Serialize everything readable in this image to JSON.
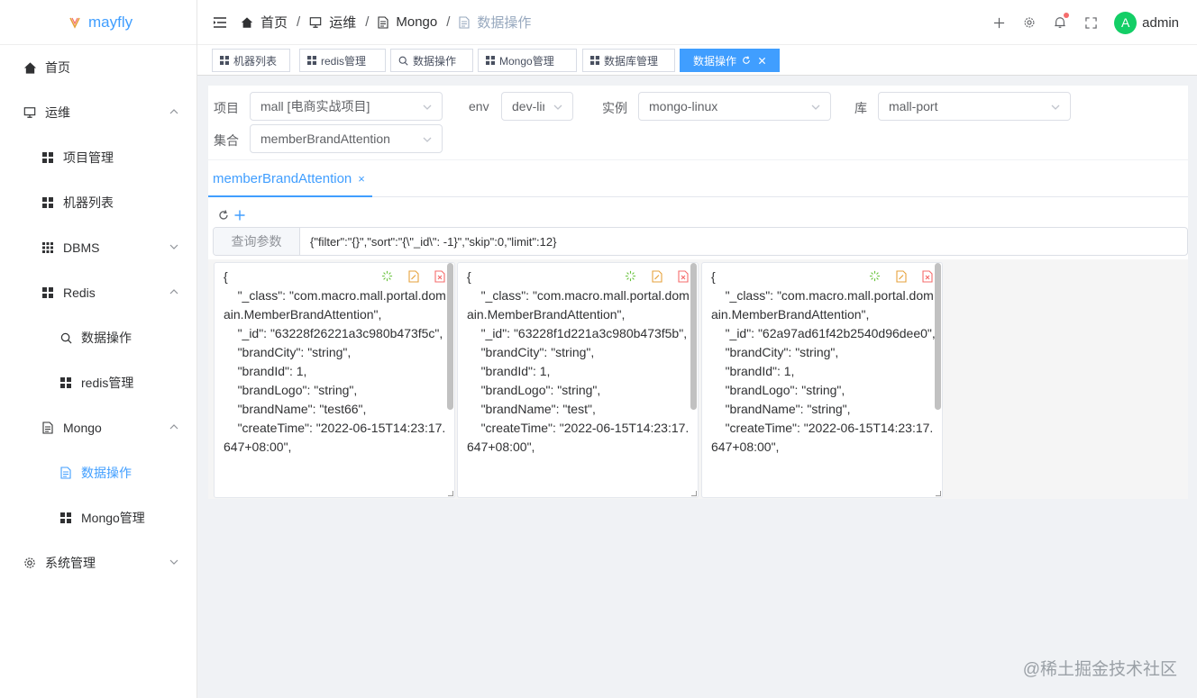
{
  "app": {
    "logo_text": "mayfly"
  },
  "sidebar": {
    "items": [
      {
        "label": "首页",
        "icon": "home-icon"
      },
      {
        "label": "运维",
        "icon": "monitor-icon",
        "expanded": true
      },
      {
        "label": "项目管理",
        "icon": "grid-icon"
      },
      {
        "label": "机器列表",
        "icon": "grid-icon"
      },
      {
        "label": "DBMS",
        "icon": "grid-icon",
        "expanded": false
      },
      {
        "label": "Redis",
        "icon": "grid-icon",
        "expanded": true
      },
      {
        "label": "数据操作",
        "icon": "search-icon"
      },
      {
        "label": "redis管理",
        "icon": "grid-icon"
      },
      {
        "label": "Mongo",
        "icon": "document-icon",
        "expanded": true
      },
      {
        "label": "数据操作",
        "icon": "document-icon",
        "active": true
      },
      {
        "label": "Mongo管理",
        "icon": "grid-icon"
      },
      {
        "label": "系统管理",
        "icon": "gear-icon",
        "expanded": false
      }
    ]
  },
  "header": {
    "breadcrumb": [
      "首页",
      "运维",
      "Mongo",
      "数据操作"
    ],
    "user": "admin",
    "avatar_letter": "A"
  },
  "tags": [
    {
      "label": "机器列表",
      "icon": "grid-icon"
    },
    {
      "label": "redis管理",
      "icon": "grid-icon"
    },
    {
      "label": "数据操作",
      "icon": "search-icon"
    },
    {
      "label": "Mongo管理",
      "icon": "grid-icon"
    },
    {
      "label": "数据库管理",
      "icon": "grid-icon"
    },
    {
      "label": "数据操作",
      "icon": "document-icon",
      "active": true
    }
  ],
  "filters": {
    "project_label": "项目",
    "project_value": "mall [电商实战项目]",
    "env_label": "env",
    "env_value": "dev-linux",
    "instance_label": "实例",
    "instance_value": "mongo-linux",
    "db_label": "库",
    "db_value": "mall-port",
    "collection_label": "集合",
    "collection_value": "memberBrandAttention"
  },
  "tab": {
    "label": "memberBrandAttention",
    "close": "×"
  },
  "query": {
    "prepend": "查询参数",
    "value": "{\"filter\":\"{}\",\"sort\":\"{\\\"_id\\\": -1}\",\"skip\":0,\"limit\":12}"
  },
  "documents": [
    "{\n    \"_class\": \"com.macro.mall.portal.domain.MemberBrandAttention\",\n    \"_id\": \"63228f26221a3c980b473f5c\",\n    \"brandCity\": \"string\",\n    \"brandId\": 1,\n    \"brandLogo\": \"string\",\n    \"brandName\": \"test66\",\n    \"createTime\": \"2022-06-15T14:23:17.647+08:00\",",
    "{\n    \"_class\": \"com.macro.mall.portal.domain.MemberBrandAttention\",\n    \"_id\": \"63228f1d221a3c980b473f5b\",\n    \"brandCity\": \"string\",\n    \"brandId\": 1,\n    \"brandLogo\": \"string\",\n    \"brandName\": \"test\",\n    \"createTime\": \"2022-06-15T14:23:17.647+08:00\",",
    "{\n    \"_class\": \"com.macro.mall.portal.domain.MemberBrandAttention\",\n    \"_id\": \"62a97ad61f42b2540d96dee0\",\n    \"brandCity\": \"string\",\n    \"brandId\": 1,\n    \"brandLogo\": \"string\",\n    \"brandName\": \"string\",\n    \"createTime\": \"2022-06-15T14:23:17.647+08:00\","
  ],
  "watermark": "@稀土掘金技术社区",
  "colors": {
    "primary": "#409eff",
    "add": "#67c23a",
    "edit": "#e6a23c",
    "delete": "#f56c6c"
  }
}
